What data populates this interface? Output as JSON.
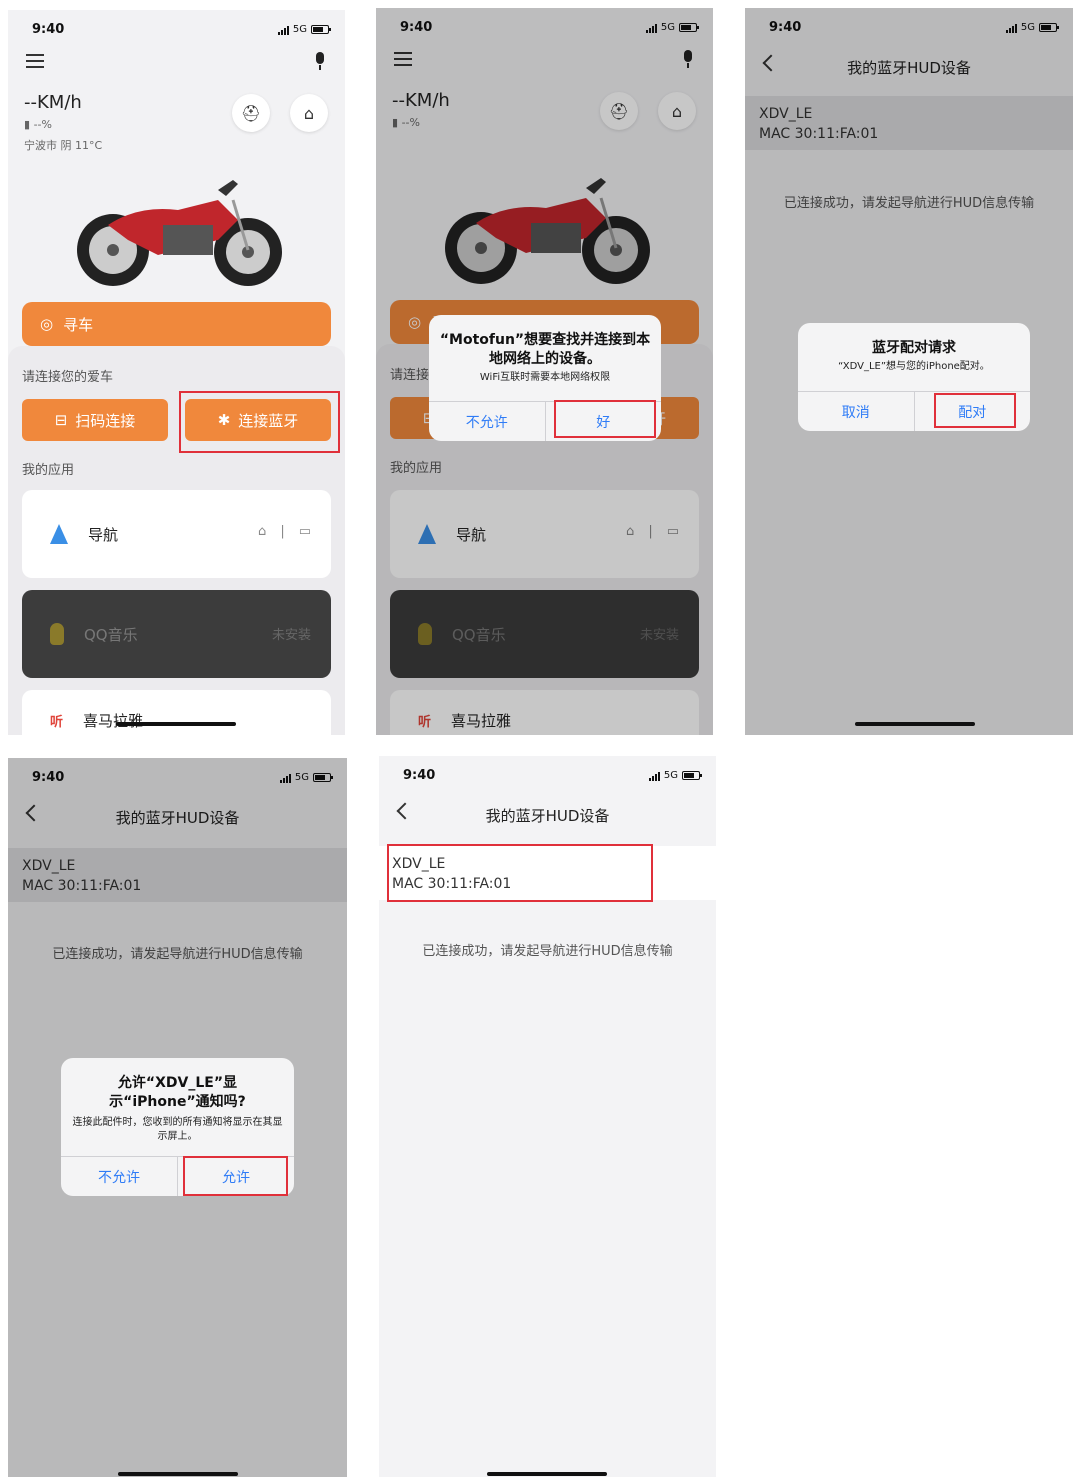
{
  "status": {
    "time": "9:40",
    "network": "5G"
  },
  "home": {
    "speed": "--KM/h",
    "fuel": "--%",
    "weather": "宁波市 阴 11°C",
    "find_car": "寻车",
    "connect_hint": "请连接您的爱车",
    "scan_connect": "扫码连接",
    "bluetooth_connect": "连接蓝牙",
    "my_apps": "我的应用",
    "apps": [
      {
        "name": "导航",
        "extra": ""
      },
      {
        "name": "QQ音乐",
        "extra": "未安装"
      },
      {
        "name": "喜马拉雅",
        "extra": ""
      }
    ]
  },
  "alert_local_network": {
    "title": "“Motofun”想要查找并连接到本地网络上的设备。",
    "message": "WiFi互联时需要本地网络权限",
    "deny": "不允许",
    "ok": "好"
  },
  "hud": {
    "title": "我的蓝牙HUD设备",
    "device_name": "XDV_LE",
    "device_mac": "MAC 30:11:FA:01",
    "success_text": "已连接成功，请发起导航进行HUD信息传输"
  },
  "alert_pairing": {
    "title": "蓝牙配对请求",
    "message": "“XDV_LE”想与您的iPhone配对。",
    "cancel": "取消",
    "pair": "配对"
  },
  "alert_notify": {
    "title": "允许“XDV_LE”显示“iPhone”通知吗?",
    "message": "连接此配件时，您收到的所有通知将显示在其显示屏上。",
    "deny": "不允许",
    "allow": "允许"
  }
}
